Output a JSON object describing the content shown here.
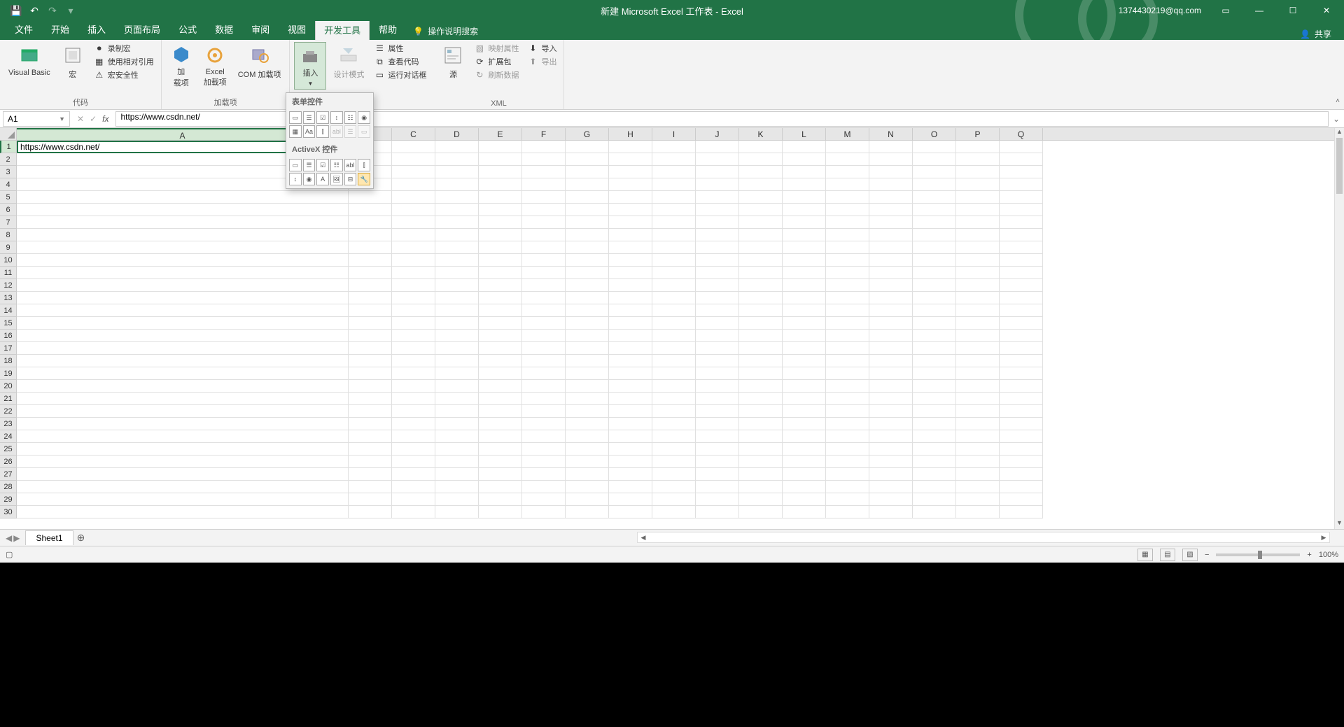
{
  "title": "新建 Microsoft Excel 工作表 - Excel",
  "user": "1374430219@qq.com",
  "share": "共享",
  "tabs": [
    "文件",
    "开始",
    "插入",
    "页面布局",
    "公式",
    "数据",
    "审阅",
    "视图",
    "开发工具",
    "帮助"
  ],
  "active_tab": 8,
  "tell_me": "操作说明搜索",
  "ribbon": {
    "code": {
      "vb": "Visual Basic",
      "macros": "宏",
      "record": "录制宏",
      "relative": "使用相对引用",
      "security": "宏安全性",
      "label": "代码"
    },
    "addins": {
      "addins": "加\n载项",
      "excel_addins": "Excel\n加载项",
      "com": "COM 加载项",
      "label": "加载项"
    },
    "controls": {
      "insert": "插入",
      "design": "设计模式",
      "props": "属性",
      "viewcode": "查看代码",
      "rundlg": "运行对话框"
    },
    "xml": {
      "source": "源",
      "map": "映射属性",
      "expand": "扩展包",
      "refresh": "刷新数据",
      "import": "导入",
      "export": "导出",
      "label": "XML"
    }
  },
  "dropdown": {
    "form_header": "表单控件",
    "activex_header": "ActiveX 控件"
  },
  "namebox": "A1",
  "formula": "https://www.csdn.net/",
  "columns": [
    "A",
    "B",
    "C",
    "D",
    "E",
    "F",
    "G",
    "H",
    "I",
    "J",
    "K",
    "L",
    "M",
    "N",
    "O",
    "P",
    "Q"
  ],
  "rows": 30,
  "cell_a1": "https://www.csdn.net/",
  "sheet": "Sheet1",
  "zoom": "100%"
}
